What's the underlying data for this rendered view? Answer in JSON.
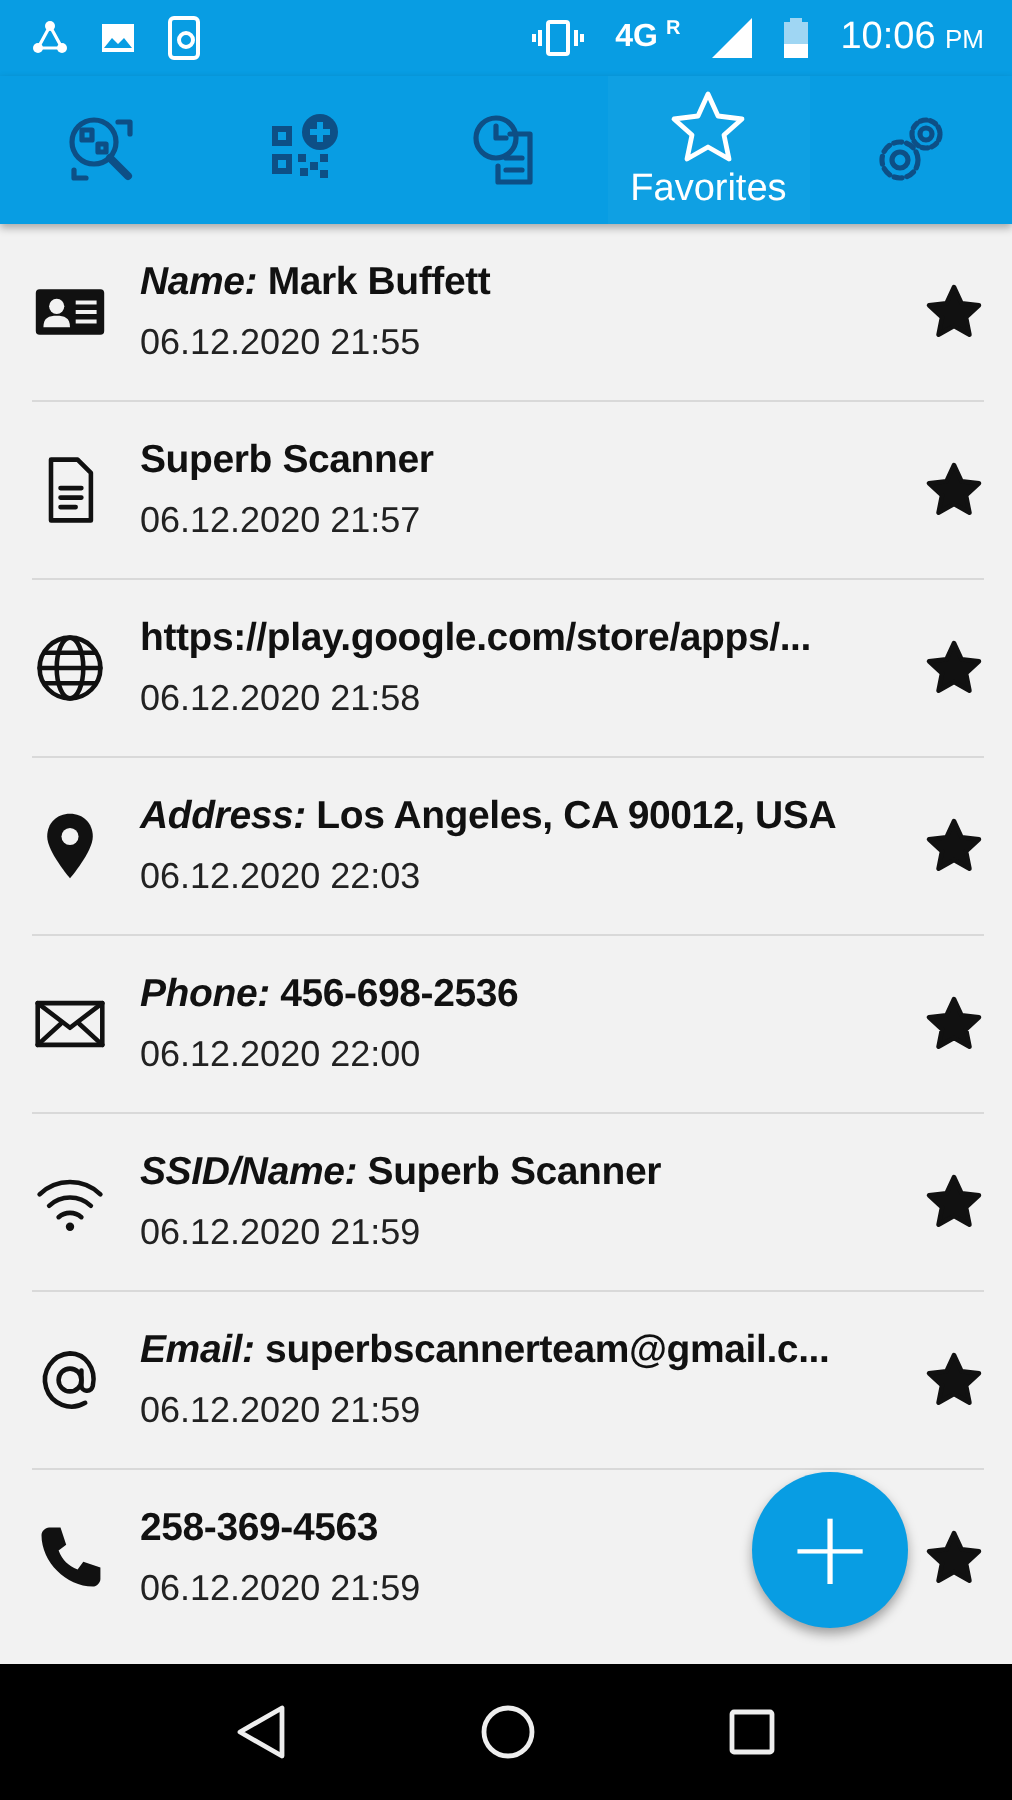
{
  "status_bar": {
    "network": "4G",
    "roaming": "R",
    "time": "10:06",
    "meridiem": "PM"
  },
  "tabs": [
    {
      "kind": "scan",
      "selected": false
    },
    {
      "kind": "create",
      "selected": false
    },
    {
      "kind": "history",
      "selected": false
    },
    {
      "kind": "favorites",
      "label": "Favorites",
      "selected": true
    },
    {
      "kind": "settings",
      "selected": false
    }
  ],
  "rows": [
    {
      "kind": "contact",
      "title": "*Name:* Mark Buffett",
      "date": "06.12.2020 21:55",
      "favorite": true
    },
    {
      "kind": "text",
      "title": "Superb Scanner",
      "date": "06.12.2020 21:57",
      "favorite": true
    },
    {
      "kind": "url",
      "title": "https://play.google.com/store/apps/...",
      "date": "06.12.2020 21:58",
      "favorite": true
    },
    {
      "kind": "location",
      "title": "*Address:* Los Angeles, CA 90012, USA",
      "date": "06.12.2020 22:03",
      "favorite": true
    },
    {
      "kind": "sms",
      "title": "*Phone:* 456-698-2536",
      "date": "06.12.2020 22:00",
      "favorite": true
    },
    {
      "kind": "wifi",
      "title": "*SSID/Name:* Superb Scanner",
      "date": "06.12.2020 21:59",
      "favorite": true
    },
    {
      "kind": "email",
      "title": "*Email:* superbscannerteam@gmail.c...",
      "date": "06.12.2020 21:59",
      "favorite": true
    },
    {
      "kind": "phone",
      "title": "258-369-4563",
      "date": "06.12.2020 21:59",
      "favorite": true
    }
  ],
  "fab": {
    "label": "+"
  }
}
